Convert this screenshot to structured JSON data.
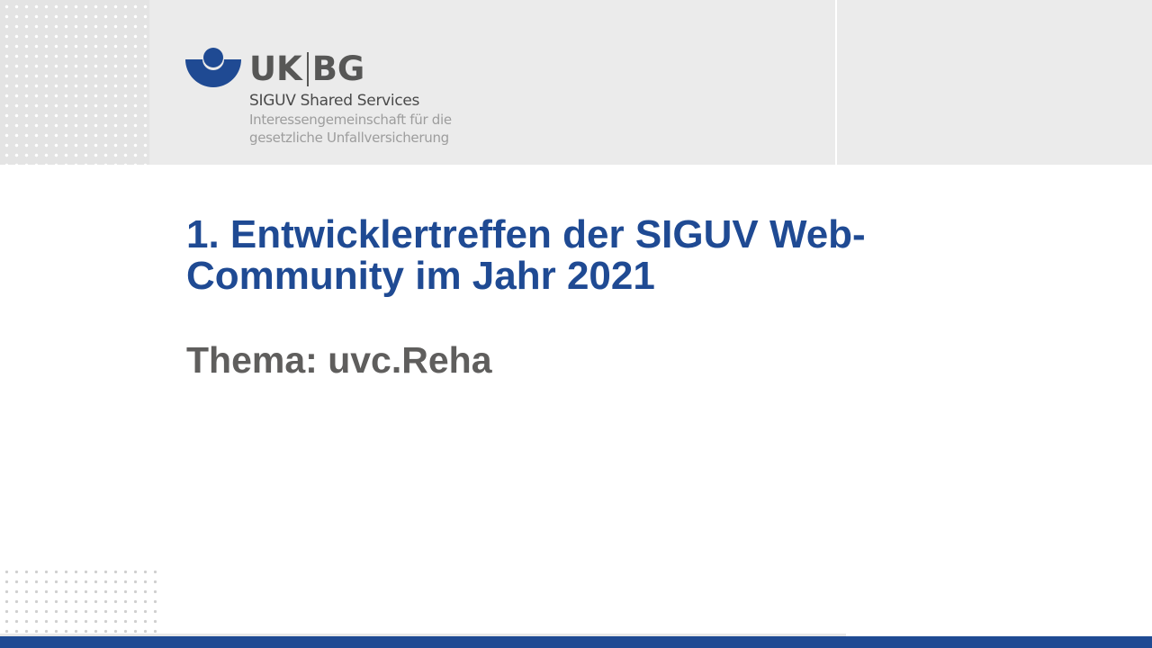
{
  "logo": {
    "brand_left": "UK",
    "brand_right": "BG",
    "line1": "SIGUV Shared Services",
    "line2": "Interessengemeinschaft für die",
    "line3": "gesetzliche Unfallversicherung",
    "color": "#1f4a93"
  },
  "slide": {
    "title": "1. Entwicklertreffen der SIGUV Web-Community im Jahr 2021",
    "subtitle": "Thema: uvc.Reha"
  },
  "colors": {
    "accent_blue": "#1f4a93",
    "title_gray": "#5f5e5d",
    "header_gray": "#ebebeb"
  }
}
